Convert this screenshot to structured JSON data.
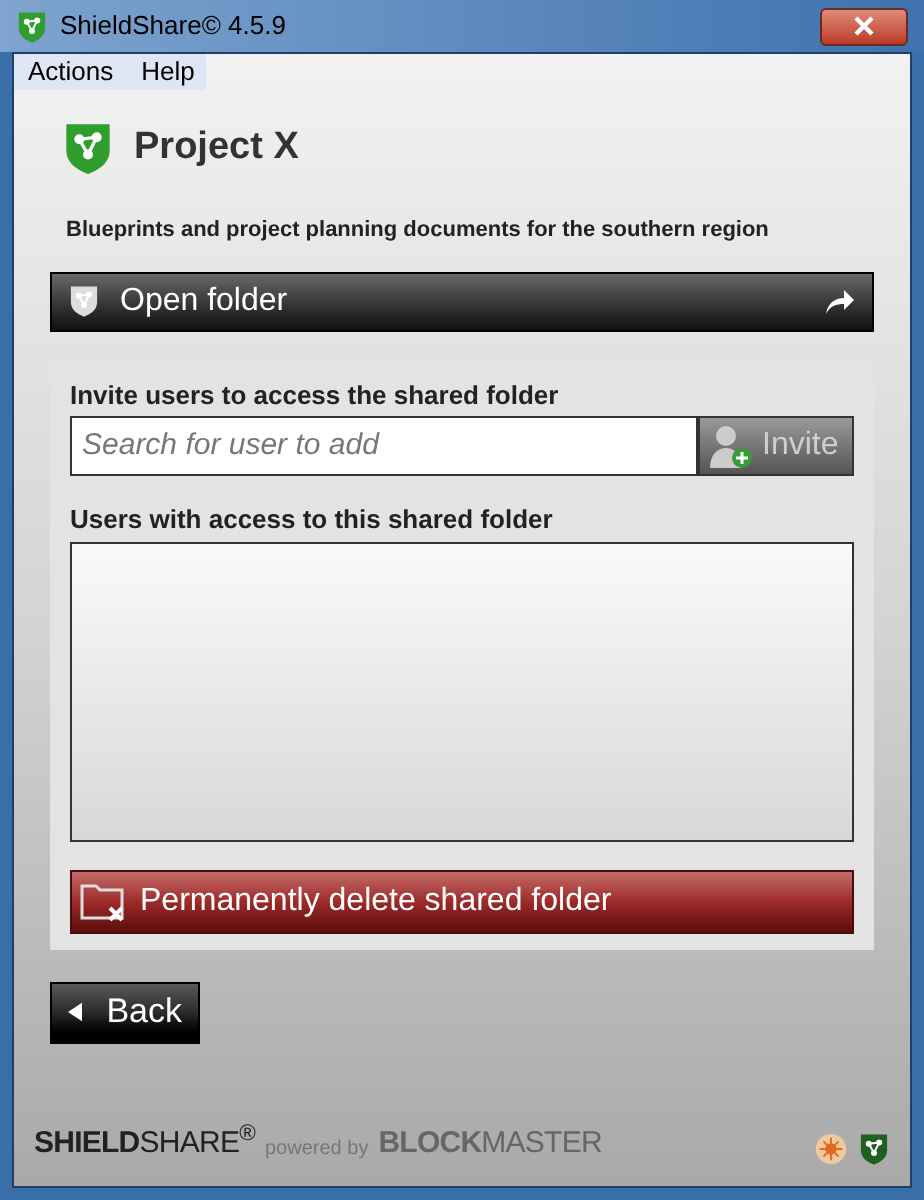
{
  "window": {
    "title": "ShieldShare© 4.5.9"
  },
  "menu": [
    {
      "label": "Actions"
    },
    {
      "label": "Help"
    }
  ],
  "project": {
    "title": "Project X",
    "description": "Blueprints and project planning documents for the southern region"
  },
  "open_button": {
    "label": "Open folder"
  },
  "invite": {
    "label": "Invite users to access the shared folder",
    "placeholder": "Search for user to add",
    "button": "Invite",
    "disabled": true
  },
  "access": {
    "label": "Users with access to this shared folder"
  },
  "delete_button": {
    "label": "Permanently delete shared folder"
  },
  "back_button": {
    "label": "Back"
  },
  "footer": {
    "brand": "**SHIELD**SHARE$^{®}$",
    "powered": "powered by",
    "company": "**BLOCK**MASTER"
  }
}
